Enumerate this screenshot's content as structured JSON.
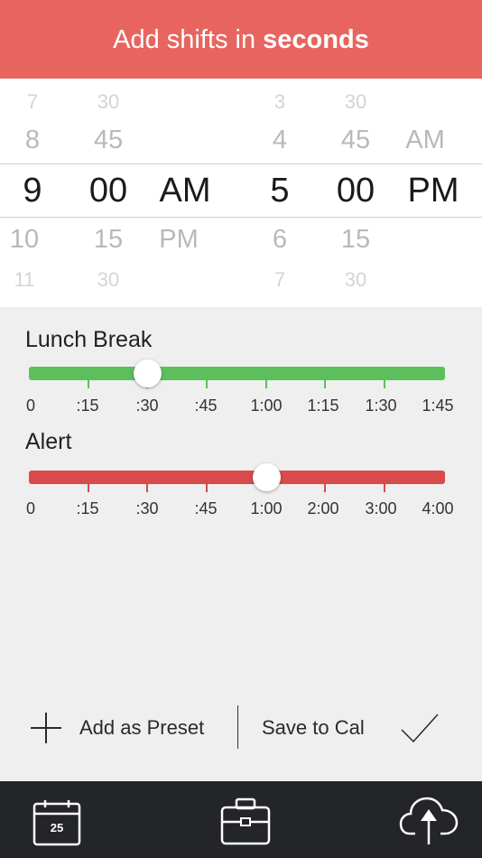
{
  "header": {
    "title_prefix": "Add shifts in ",
    "title_bold": "seconds"
  },
  "picker": {
    "start": {
      "hours": [
        "7",
        "8",
        "9",
        "10",
        "11"
      ],
      "minutes": [
        "30",
        "45",
        "00",
        "15",
        "30"
      ],
      "ampm": [
        "",
        "",
        "AM",
        "PM",
        ""
      ]
    },
    "end": {
      "hours": [
        "3",
        "4",
        "5",
        "6",
        "7"
      ],
      "minutes": [
        "30",
        "45",
        "00",
        "15",
        "30"
      ],
      "ampm": [
        "",
        "AM",
        "PM",
        "",
        ""
      ]
    }
  },
  "lunch_break": {
    "label": "Lunch Break",
    "color": "#5dbf5c",
    "ticks": [
      "0",
      ":15",
      ":30",
      ":45",
      "1:00",
      "1:15",
      "1:30",
      "1:45"
    ],
    "value": ":30"
  },
  "alert": {
    "label": "Alert",
    "color": "#d94a4b",
    "ticks": [
      "0",
      ":15",
      ":30",
      ":45",
      "1:00",
      "2:00",
      "3:00",
      "4:00"
    ],
    "value": "1:00"
  },
  "actions": {
    "add_preset": "Add as Preset",
    "save_cal": "Save to Cal"
  },
  "tabbar": {
    "calendar_day": "25",
    "icons": [
      "calendar-icon",
      "briefcase-icon",
      "cloud-upload-icon"
    ]
  },
  "colors": {
    "header": "#e8655f",
    "tabbar": "#242529",
    "background": "#efefef"
  }
}
